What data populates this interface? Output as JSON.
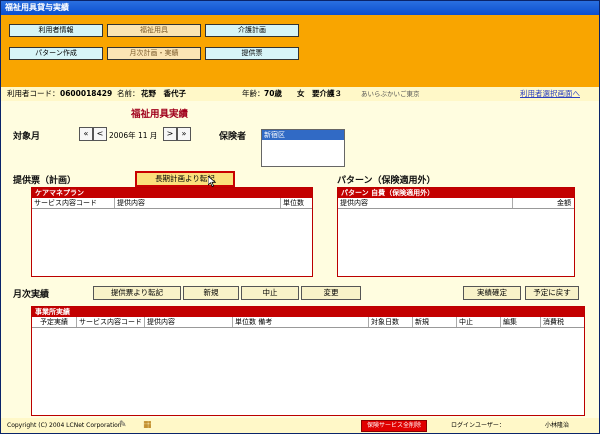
{
  "window": {
    "title": "福祉用具貸与実績"
  },
  "nav": {
    "row1": [
      "利用者情報",
      "福祉用具",
      "介護計画"
    ],
    "row2": [
      "パターン作成",
      "月次計画・実績",
      "提供票"
    ]
  },
  "user": {
    "code_label": "利用者コード：",
    "code": "0600018429",
    "name_label": "名前：",
    "name": "花野　香代子",
    "age_label": "年齢：",
    "age": "70歳",
    "gender": "女",
    "care": "要介護３",
    "office": "あいらぶかいご東京",
    "select_link": "利用者選択画面へ"
  },
  "main": {
    "page_title": "福祉用具実績",
    "target_month_label": "対象月",
    "month_first": "«",
    "month_prev": "<",
    "month_text": "2006年 11 月",
    "month_next": ">",
    "month_last": "»",
    "insurer_label": "保険者",
    "insurer_option": "新宿区"
  },
  "plan": {
    "label": "提供票（計画）",
    "transfer_button": "長期計画より転記",
    "panel_title": "ケアマネプラン",
    "columns": [
      "サービス内容コード",
      "提供内容",
      "単位数"
    ]
  },
  "pattern": {
    "label": "パターン（保険適用外）",
    "panel_title": "パターン 自費（保険適用外）",
    "columns": [
      "提供内容",
      "金額"
    ]
  },
  "monthly": {
    "label": "月次実績",
    "buttons": [
      "提供票より転記",
      "新規",
      "中止",
      "変更"
    ],
    "confirm_button": "実績確定",
    "revert_button": "予定に戻す",
    "panel_title": "事業所実績",
    "columns": [
      "予定実績",
      "サービス内容コード",
      "提供内容",
      "単位数 備考",
      "対象日数",
      "新規",
      "中止",
      "編集",
      "消費税"
    ]
  },
  "footer": {
    "copyright": "Copyright (C) 2004 LCNet Corporation",
    "delete_all": "保険サービス全削除",
    "login_label": "ログインユーザー：",
    "login_user": "小林隆治"
  }
}
